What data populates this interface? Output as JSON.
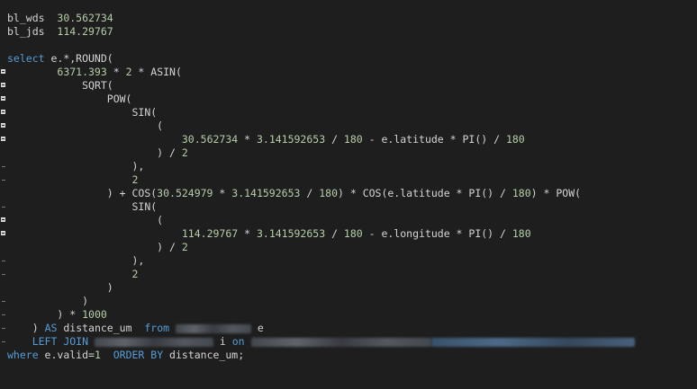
{
  "variables": [
    {
      "name": "bl_wds",
      "value": "30.562734"
    },
    {
      "name": "bl_jds",
      "value": "114.29767"
    }
  ],
  "sql": {
    "l1_kw": "select",
    "l1_rest": " e.*,ROUND(",
    "l2_num1": "6371.393",
    "l2_op": " * ",
    "l2_num2": "2",
    "l2_rest": " * ASIN(",
    "l3": "SQRT(",
    "l4": "POW(",
    "l5": "SIN(",
    "l6": "(",
    "l7_num1": "30.562734",
    "l7_op1": " * ",
    "l7_num2": "3.141592653",
    "l7_op2": " / ",
    "l7_num3": "180",
    "l7_rest": " - e.latitude * PI() / ",
    "l7_num4": "180",
    "l8_pre": ") / ",
    "l8_num": "2",
    "l9": "),",
    "l10_num": "2",
    "l11_pre": ") + COS(",
    "l11_num1": "30.524979",
    "l11_op1": " * ",
    "l11_num2": "3.141592653",
    "l11_op2": " / ",
    "l11_num3": "180",
    "l11_rest": ") * COS(e.latitude * PI() / ",
    "l11_num4": "180",
    "l11_end": ") * POW(",
    "l12": "SIN(",
    "l13": "(",
    "l14_num1": "114.29767",
    "l14_op1": " * ",
    "l14_num2": "3.141592653",
    "l14_op2": " / ",
    "l14_num3": "180",
    "l14_rest": " - e.longitude * PI() / ",
    "l14_num4": "180",
    "l15_pre": ") / ",
    "l15_num": "2",
    "l16": "),",
    "l17_num": "2",
    "l18": ")",
    "l19": ")",
    "l20_pre": ") * ",
    "l20_num": "1000",
    "l21_pre": ") ",
    "l21_kw1": "AS",
    "l21_mid": " distance_um  ",
    "l21_kw2": "from",
    "l21_end": " e",
    "l22_kw1": "LEFT JOIN",
    "l22_mid": " i ",
    "l22_kw2": "on",
    "l23_kw1": "where",
    "l23_mid": " e.valid=",
    "l23_num": "1",
    "l23_gap": "  ",
    "l23_kw2": "ORDER BY",
    "l23_end": " distance_um;"
  }
}
